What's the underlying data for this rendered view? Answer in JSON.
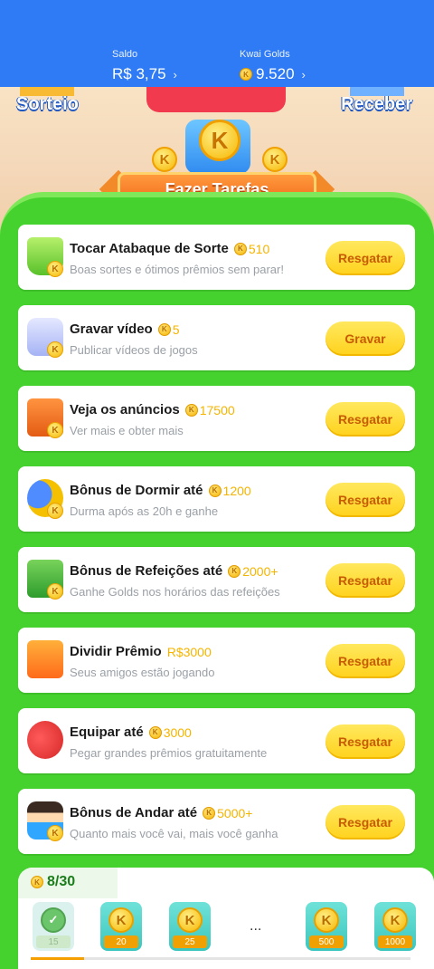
{
  "header": {
    "saldo_label": "Saldo",
    "saldo_value": "R$ 3,75",
    "golds_label": "Kwai Golds",
    "golds_value": "9.520",
    "arrow": "›"
  },
  "festive": {
    "sorteio": "Sorteio",
    "receber": "Receber",
    "banner_coin": "K",
    "title": "Fazer Tarefas"
  },
  "tasks": [
    {
      "title": "Tocar Atabaque de Sorte",
      "reward": "510",
      "subtitle": "Boas sortes e ótimos prêmios sem parar!",
      "button": "Resgatar",
      "icon": "drum-icon"
    },
    {
      "title": "Gravar vídeo",
      "reward": "5",
      "subtitle": "Publicar vídeos de jogos",
      "button": "Gravar",
      "icon": "camera-icon"
    },
    {
      "title": "Veja os anúncios",
      "reward": "17500",
      "subtitle": "Ver mais e obter mais",
      "button": "Resgatar",
      "icon": "tv-icon"
    },
    {
      "title": "Bônus de Dormir até",
      "reward": "1200",
      "subtitle": "Durma após as 20h e ganhe",
      "button": "Resgatar",
      "icon": "moon-icon"
    },
    {
      "title": "Bônus de Refeições até",
      "reward": "2000+",
      "subtitle": "Ganhe Golds nos horários das refeições",
      "button": "Resgatar",
      "icon": "meal-icon"
    },
    {
      "title": "Dividir Prêmio",
      "reward": "R$3000",
      "subtitle": "Seus amigos estão jogando",
      "button": "Resgatar",
      "icon": "gift-icon"
    },
    {
      "title": "Equipar até",
      "reward": "3000",
      "subtitle": "Pegar grandes prêmios gratuitamente",
      "button": "Resgatar",
      "icon": "boxing-glove-icon"
    },
    {
      "title": "Bônus de Andar até",
      "reward": "5000+",
      "subtitle": "Quanto mais você vai, mais você ganha",
      "button": "Resgatar",
      "icon": "boy-icon"
    }
  ],
  "progress": {
    "count": "8/30",
    "fill_fraction": 0.14,
    "days": [
      {
        "amount": "15",
        "done": true
      },
      {
        "amount": "20",
        "done": false
      },
      {
        "amount": "25",
        "done": false
      },
      {
        "amount": "500",
        "done": false
      },
      {
        "amount": "1000",
        "done": false
      }
    ],
    "ellipsis": "...",
    "coin_letter": "K"
  },
  "colors": {
    "header_blue": "#2f7bf5",
    "green": "#45d12e",
    "button_yellow": "#ffd21c",
    "button_text": "#c85a00",
    "coin": "#f6b600"
  }
}
